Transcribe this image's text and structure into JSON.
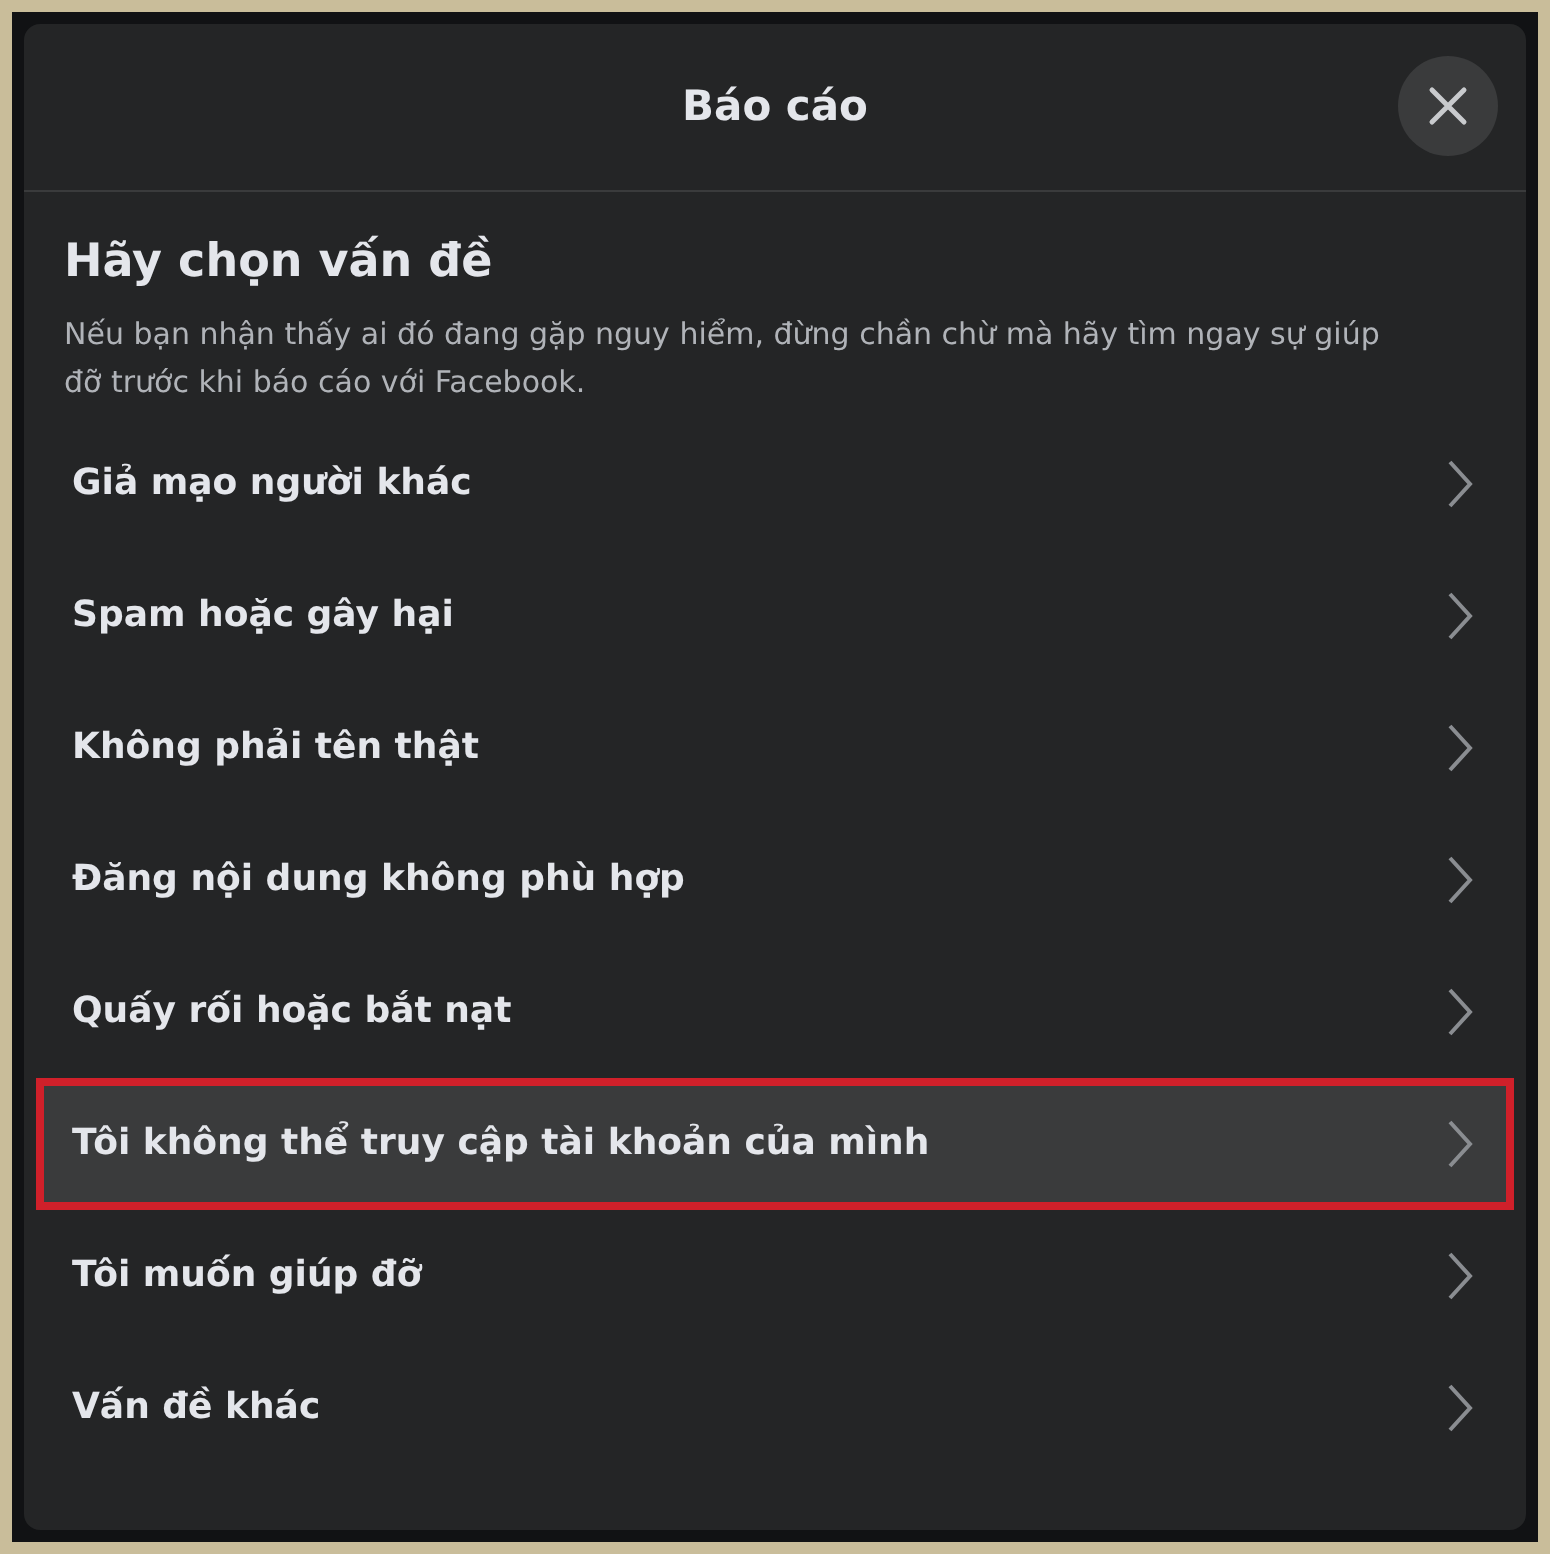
{
  "dialog": {
    "title": "Báo cáo"
  },
  "heading": "Hãy chọn vấn đề",
  "description": "Nếu bạn nhận thấy ai đó đang gặp nguy hiểm, đừng chần chừ mà hãy tìm ngay sự giúp đỡ trước khi báo cáo với Facebook.",
  "options": [
    {
      "label": "Giả mạo người khác",
      "selected": false
    },
    {
      "label": "Spam hoặc gây hại",
      "selected": false
    },
    {
      "label": "Không phải tên thật",
      "selected": false
    },
    {
      "label": "Đăng nội dung không phù hợp",
      "selected": false
    },
    {
      "label": "Quấy rối hoặc bắt nạt",
      "selected": false
    },
    {
      "label": "Tôi không thể truy cập tài khoản của mình",
      "selected": true
    },
    {
      "label": "Tôi muốn giúp đỡ",
      "selected": false
    },
    {
      "label": "Vấn đề khác",
      "selected": false
    }
  ]
}
